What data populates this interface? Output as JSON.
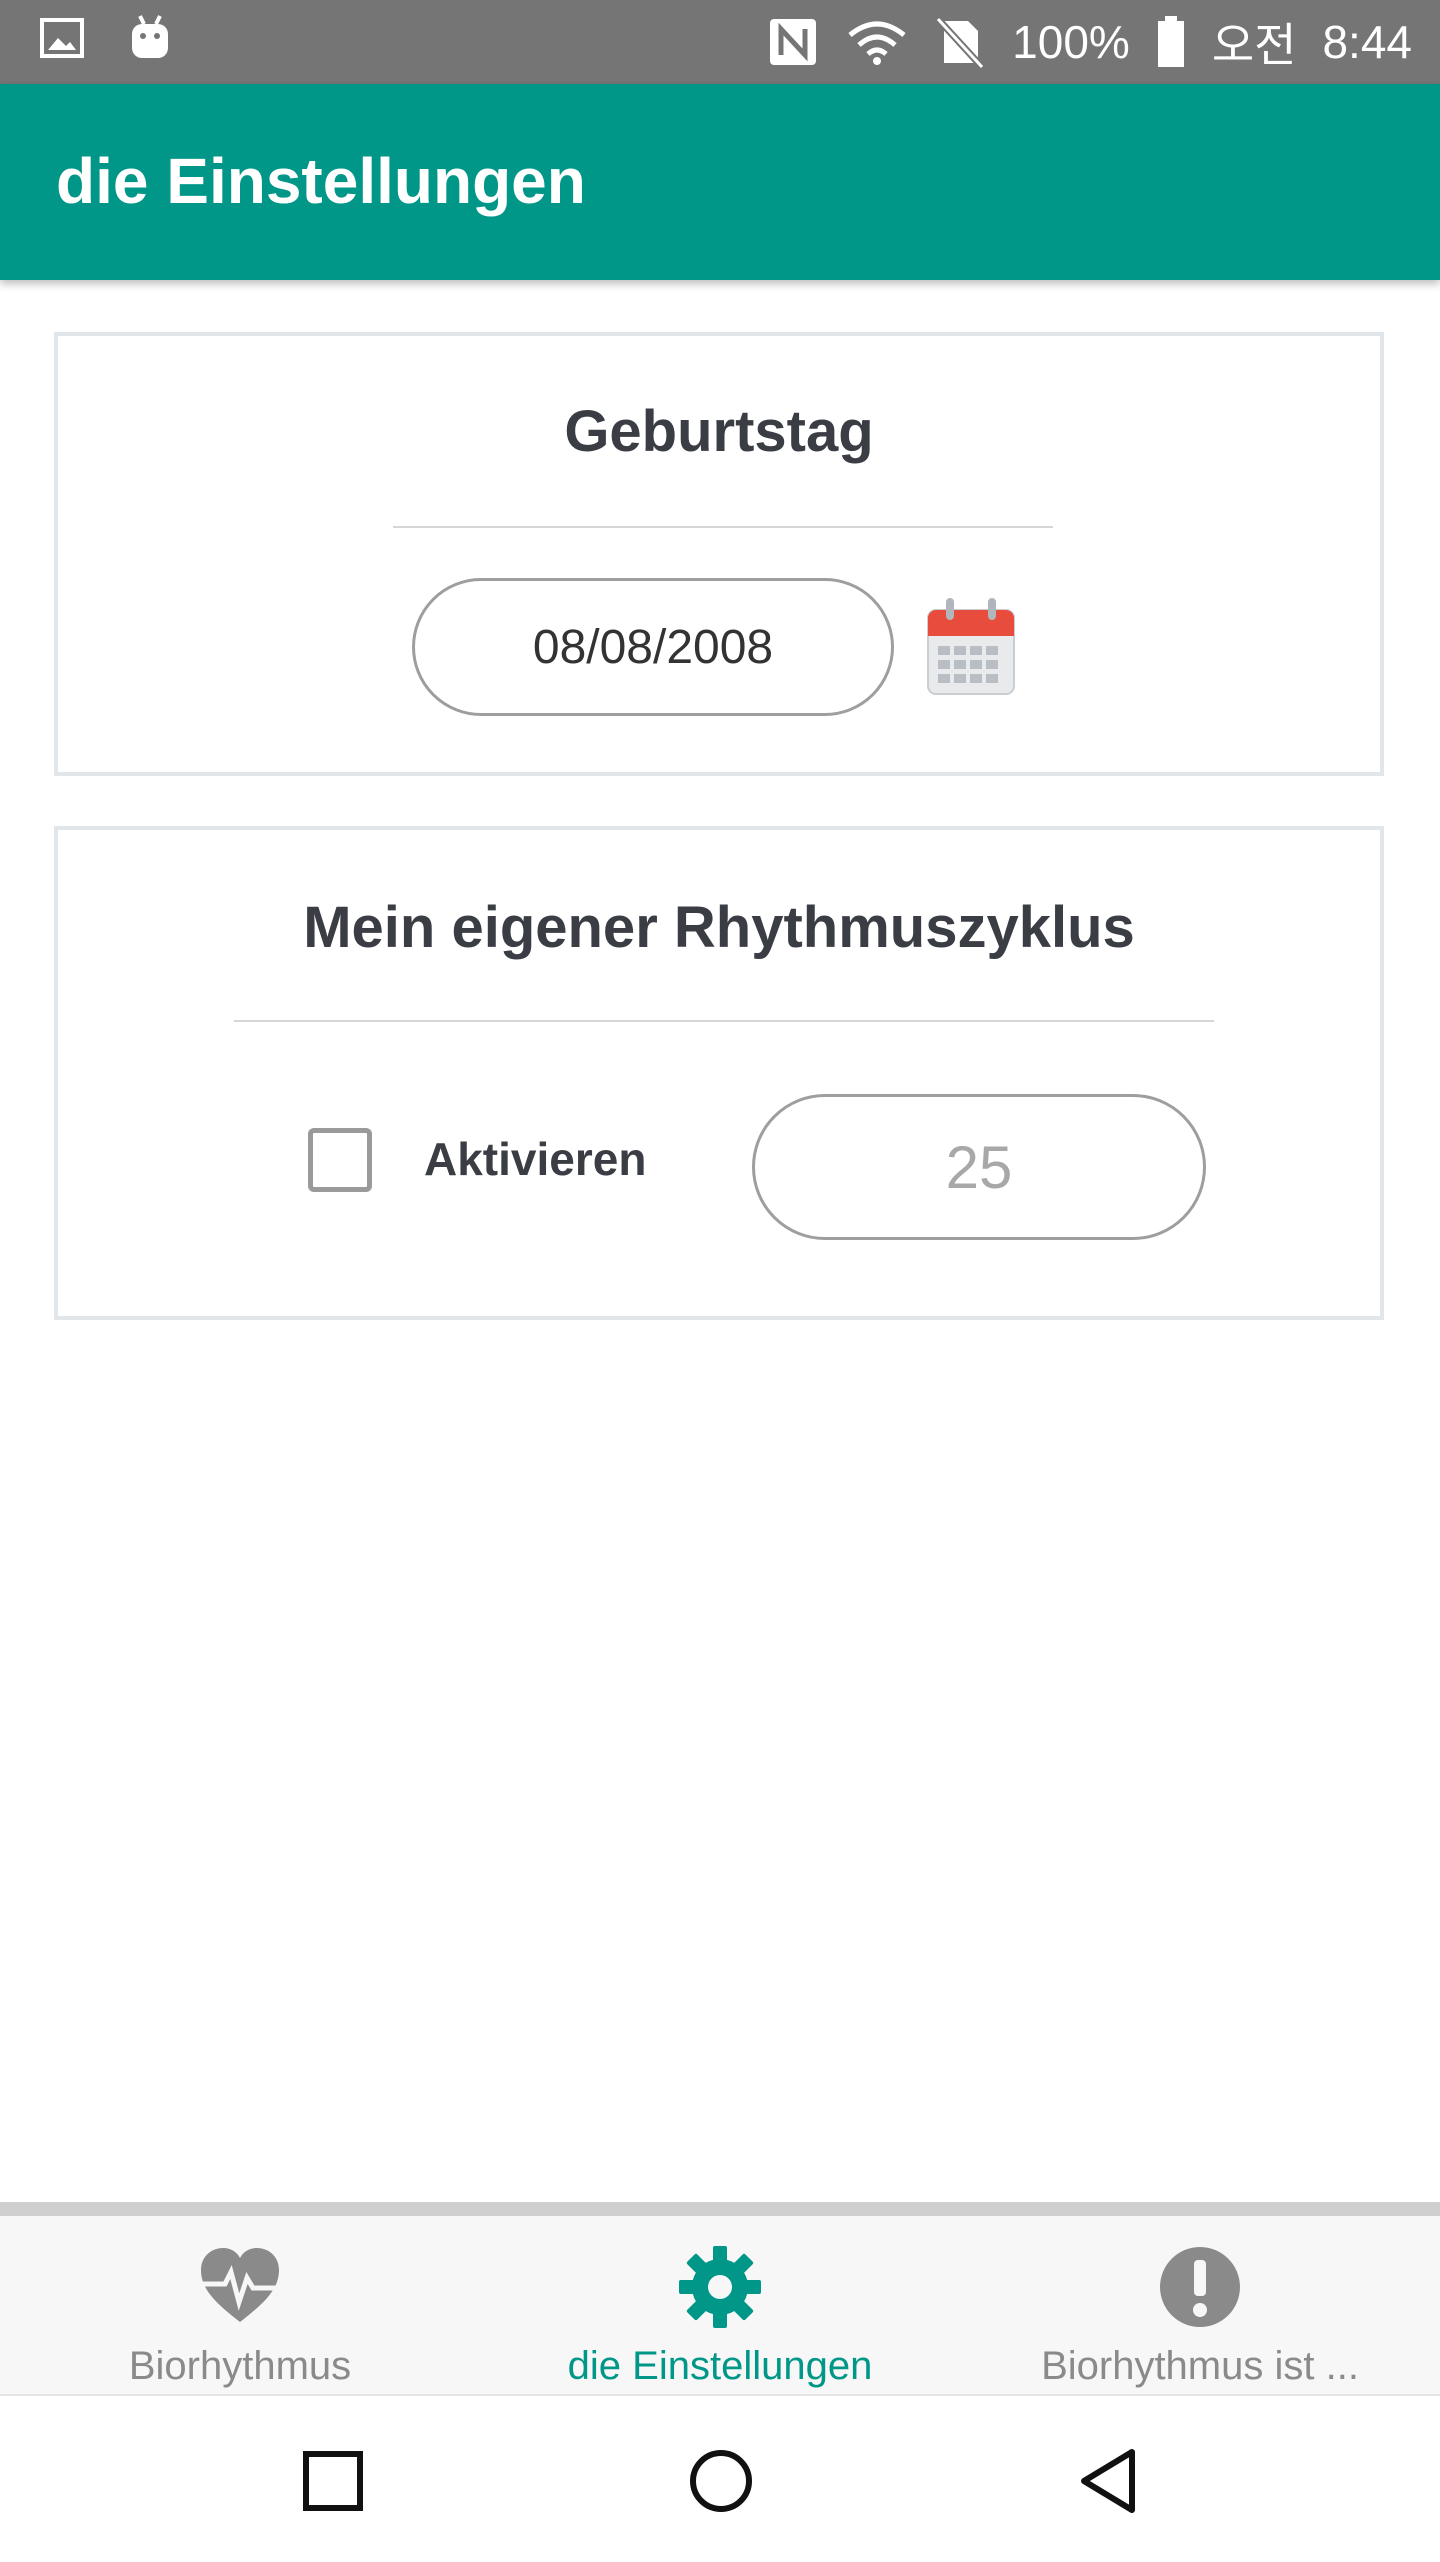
{
  "status_bar": {
    "battery": "100%",
    "ampm": "오전",
    "time": "8:44",
    "icons": [
      "image-icon",
      "android-icon",
      "nfc-icon",
      "wifi-icon",
      "no-sim-icon",
      "battery-icon"
    ]
  },
  "app_bar": {
    "title": "die Einstellungen"
  },
  "birthday_card": {
    "title": "Geburtstag",
    "date_value": "08/08/2008",
    "calendar_icon": "calendar-icon"
  },
  "rhythm_card": {
    "title": "Mein eigener Rhythmuszyklus",
    "checkbox_label": "Aktivieren",
    "checked": false,
    "cycle_value": "25"
  },
  "bottom_nav": {
    "items": [
      {
        "label": "Biorhythmus",
        "icon": "heart-pulse-icon",
        "active": false
      },
      {
        "label": "die Einstellungen",
        "icon": "gear-icon",
        "active": true
      },
      {
        "label": "Biorhythmus ist ...",
        "icon": "exclamation-icon",
        "active": false
      }
    ]
  },
  "colors": {
    "primary": "#009688",
    "status_bar": "#757575",
    "inactive": "#8a8a8a"
  }
}
